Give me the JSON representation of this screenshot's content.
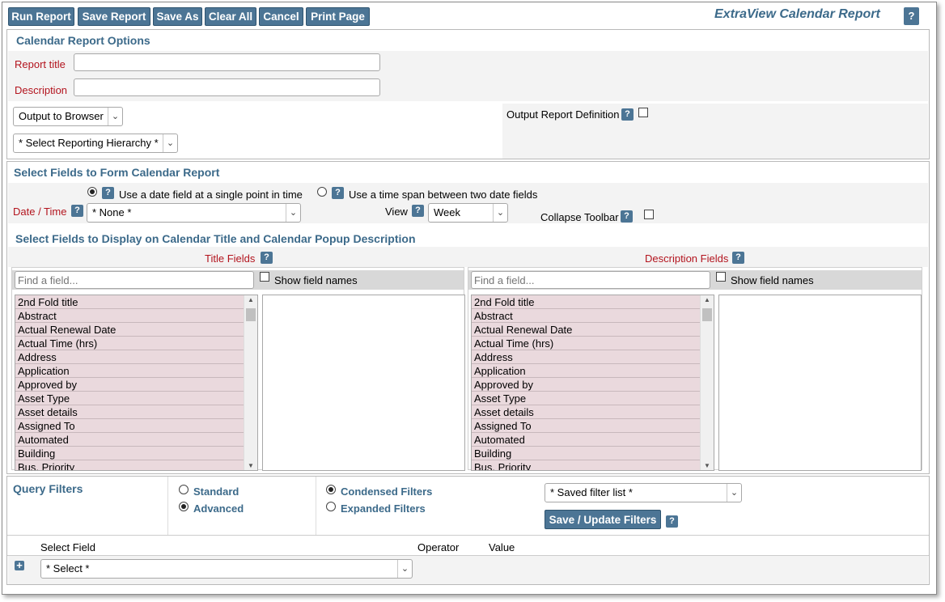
{
  "toolbar": {
    "run_report": "Run Report",
    "save_report": "Save Report",
    "save_as": "Save As",
    "clear_all": "Clear All",
    "cancel": "Cancel",
    "print_page": "Print Page",
    "app_title": "ExtraView Calendar Report",
    "help": "?"
  },
  "options": {
    "title": "Calendar Report Options",
    "report_title_label": "Report title",
    "report_title_value": "",
    "description_label": "Description",
    "description_value": "",
    "output": "Output to Browser",
    "hierarchy": "* Select Reporting Hierarchy *",
    "output_definition_label": "Output Report Definition"
  },
  "fields": {
    "title": "Select Fields to Form Calendar Report",
    "single_point_label": "Use a date field at a single point in time",
    "time_span_label": "Use a time span between two date fields",
    "date_time_label": "Date / Time",
    "date_time_value": "* None *",
    "view_label": "View",
    "view_value": "Week",
    "collapse_toolbar_label": "Collapse Toolbar"
  },
  "display": {
    "title": "Select Fields to Display on Calendar Title and Calendar Popup Description",
    "title_fields_label": "Title Fields",
    "description_fields_label": "Description Fields",
    "find_placeholder": "Find a field...",
    "show_field_names": "Show field names",
    "field_list": [
      "2nd Fold title",
      "Abstract",
      "Actual Renewal Date",
      "Actual Time (hrs)",
      "Address",
      "Application",
      "Approved by",
      "Asset Type",
      "Asset details",
      "Assigned To",
      "Automated",
      "Building",
      "Bus. Priority"
    ]
  },
  "filters": {
    "title": "Query Filters",
    "standard": "Standard",
    "advanced": "Advanced",
    "condensed": "Condensed Filters",
    "expanded": "Expanded Filters",
    "saved_list": "* Saved filter list *",
    "save_update": "Save / Update Filters",
    "col_select_field": "Select Field",
    "col_operator": "Operator",
    "col_value": "Value",
    "select_value": "* Select *",
    "add_icon": "+"
  }
}
